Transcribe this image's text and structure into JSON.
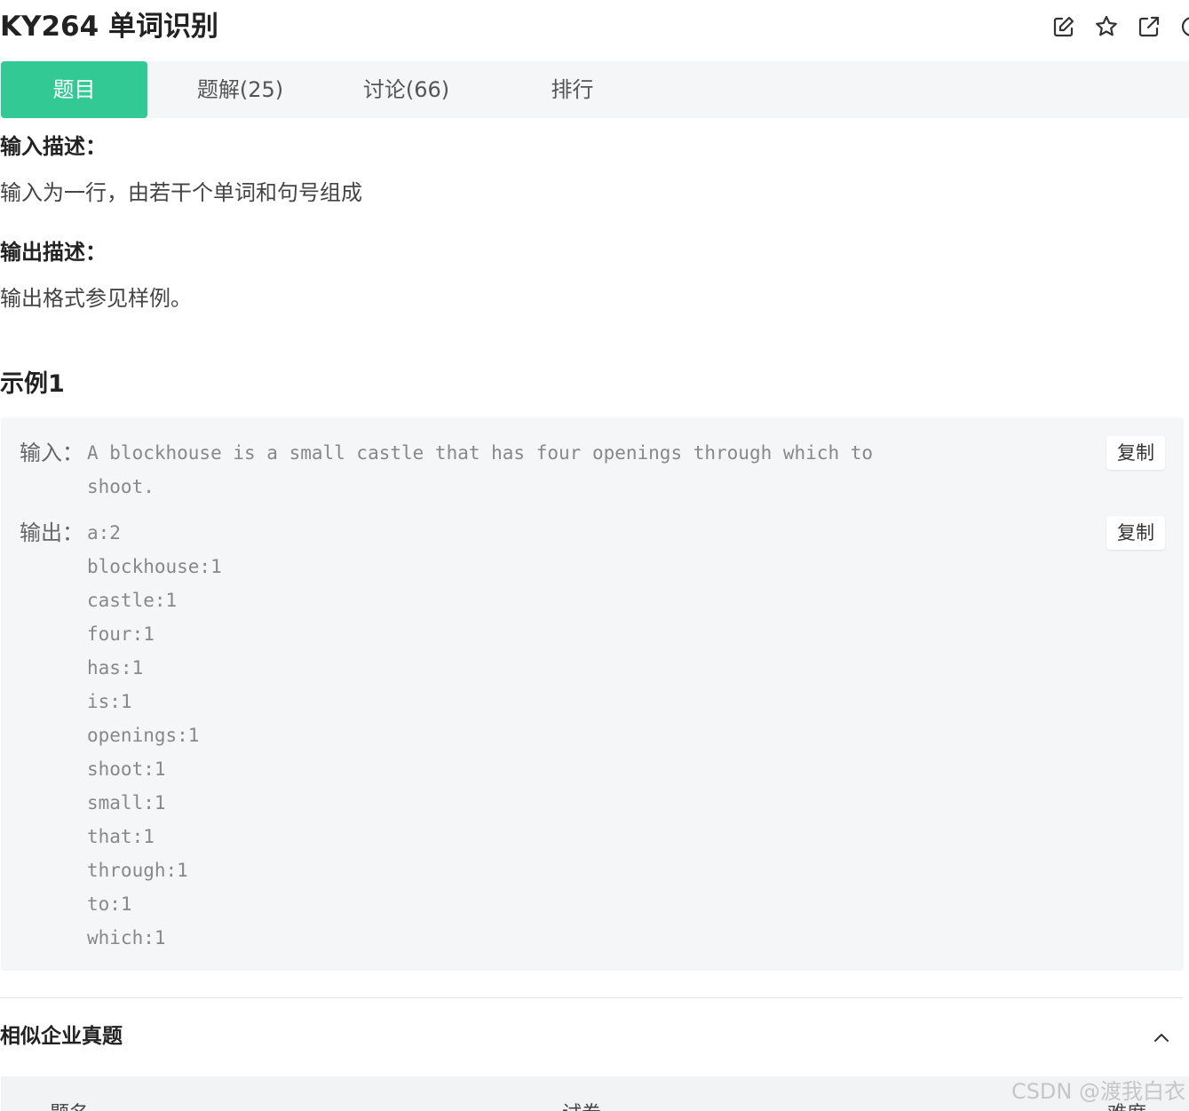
{
  "problem": {
    "title": "KY264  单词识别"
  },
  "header_icons": [
    "edit-icon",
    "star-icon",
    "share-icon",
    "more-icon"
  ],
  "tabs": [
    {
      "label": "题目",
      "active": true
    },
    {
      "label": "题解(25)",
      "active": false
    },
    {
      "label": "讨论(66)",
      "active": false
    },
    {
      "label": "排行",
      "active": false
    }
  ],
  "input_desc": {
    "heading": "输入描述：",
    "text": "输入为一行，由若干个单词和句号组成"
  },
  "output_desc": {
    "heading": "输出描述：",
    "text": "输出格式参见样例。"
  },
  "example": {
    "heading": "示例1",
    "input_label": "输入：",
    "input_lines": [
      "A blockhouse is a small castle that has four openings through which to",
      "shoot."
    ],
    "output_label": "输出：",
    "output_lines": [
      "a:2",
      "blockhouse:1",
      "castle:1",
      "four:1",
      "has:1",
      "is:1",
      "openings:1",
      "shoot:1",
      "small:1",
      "that:1",
      "through:1",
      "to:1",
      "which:1"
    ],
    "copy_label": "复制"
  },
  "similar": {
    "heading": "相似企业真题",
    "columns": [
      "题名",
      "试卷",
      "难度"
    ]
  },
  "watermark": "CSDN @渡我白衣",
  "colors": {
    "accent": "#32c995",
    "tab_bg": "#f5f6f7",
    "example_bg": "#f5f6f7"
  }
}
